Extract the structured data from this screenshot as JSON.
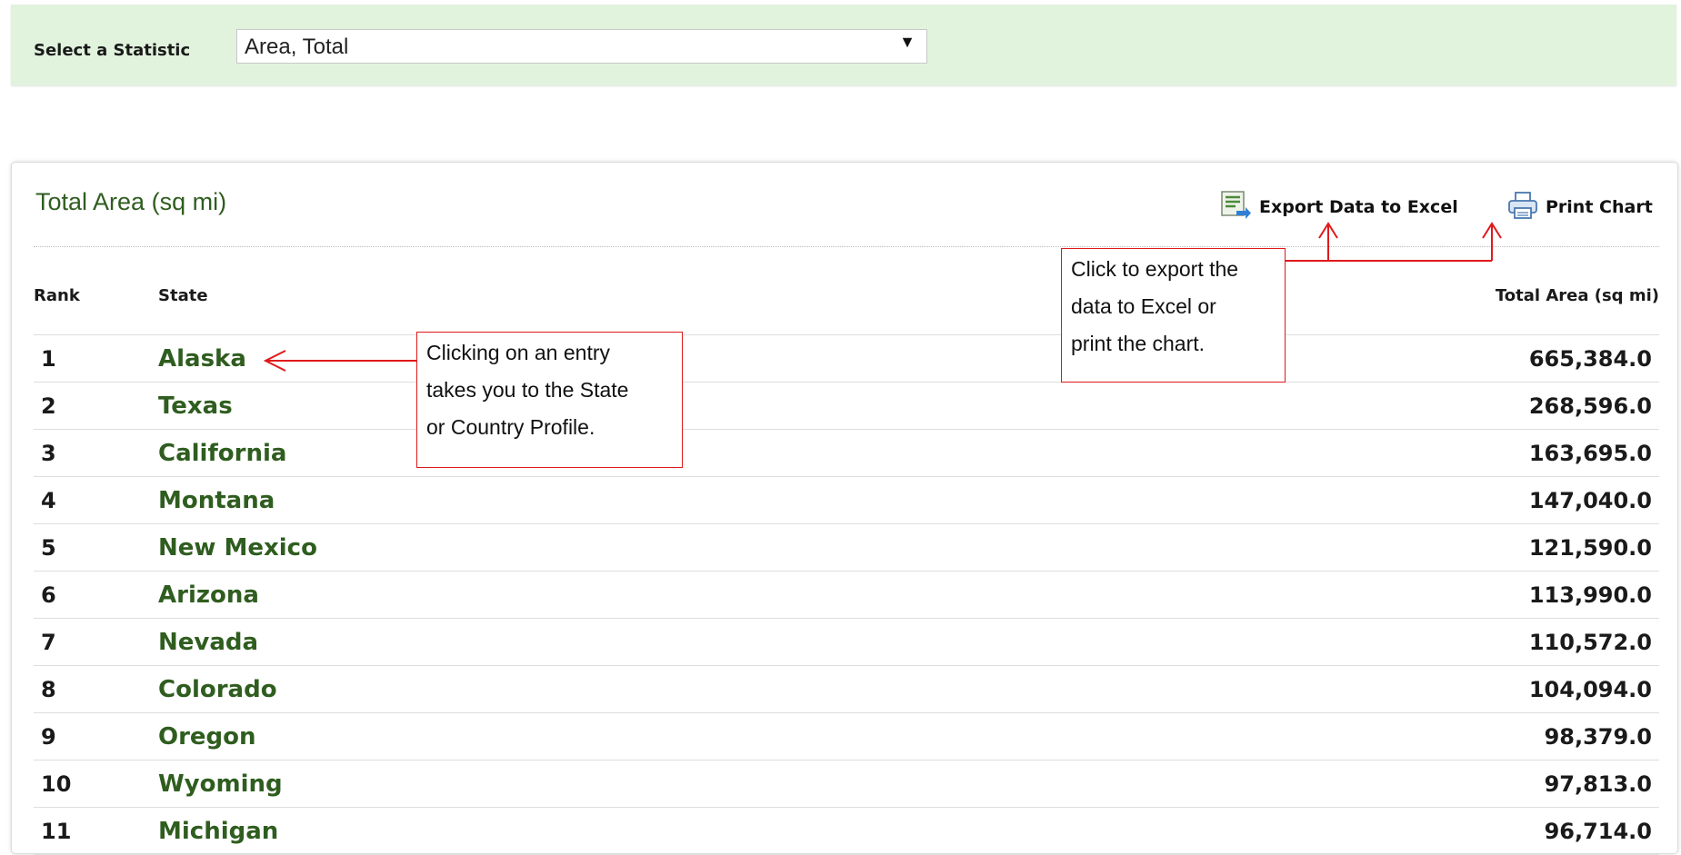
{
  "filter": {
    "label": "Select a Statistic",
    "selected_value": "Area, Total"
  },
  "panel": {
    "title": "Total Area (sq mi)",
    "export_label": "Export Data to Excel",
    "print_label": "Print Chart"
  },
  "table": {
    "columns": [
      "Rank",
      "State",
      "Total Area (sq mi)"
    ],
    "rows": [
      {
        "rank": "1",
        "state": "Alaska",
        "total": "665,384.0"
      },
      {
        "rank": "2",
        "state": "Texas",
        "total": "268,596.0"
      },
      {
        "rank": "3",
        "state": "California",
        "total": "163,695.0"
      },
      {
        "rank": "4",
        "state": "Montana",
        "total": "147,040.0"
      },
      {
        "rank": "5",
        "state": "New Mexico",
        "total": "121,590.0"
      },
      {
        "rank": "6",
        "state": "Arizona",
        "total": "113,990.0"
      },
      {
        "rank": "7",
        "state": "Nevada",
        "total": "110,572.0"
      },
      {
        "rank": "8",
        "state": "Colorado",
        "total": "104,094.0"
      },
      {
        "rank": "9",
        "state": "Oregon",
        "total": "98,379.0"
      },
      {
        "rank": "10",
        "state": "Wyoming",
        "total": "97,813.0"
      },
      {
        "rank": "11",
        "state": "Michigan",
        "total": "96,714.0"
      }
    ]
  },
  "callouts": {
    "entry": [
      "Clicking on an entry",
      "takes you to the State",
      "or Country Profile."
    ],
    "export": [
      "Click to export the",
      "data to Excel or",
      "print the chart."
    ]
  },
  "colors": {
    "filter_bg": "#e1f3dd",
    "title_green": "#2f5d1f",
    "callout_red": "#e0191b"
  },
  "icons": {
    "export": "excel-export-icon",
    "print": "printer-icon",
    "dropdown": "chevron-down-icon"
  }
}
